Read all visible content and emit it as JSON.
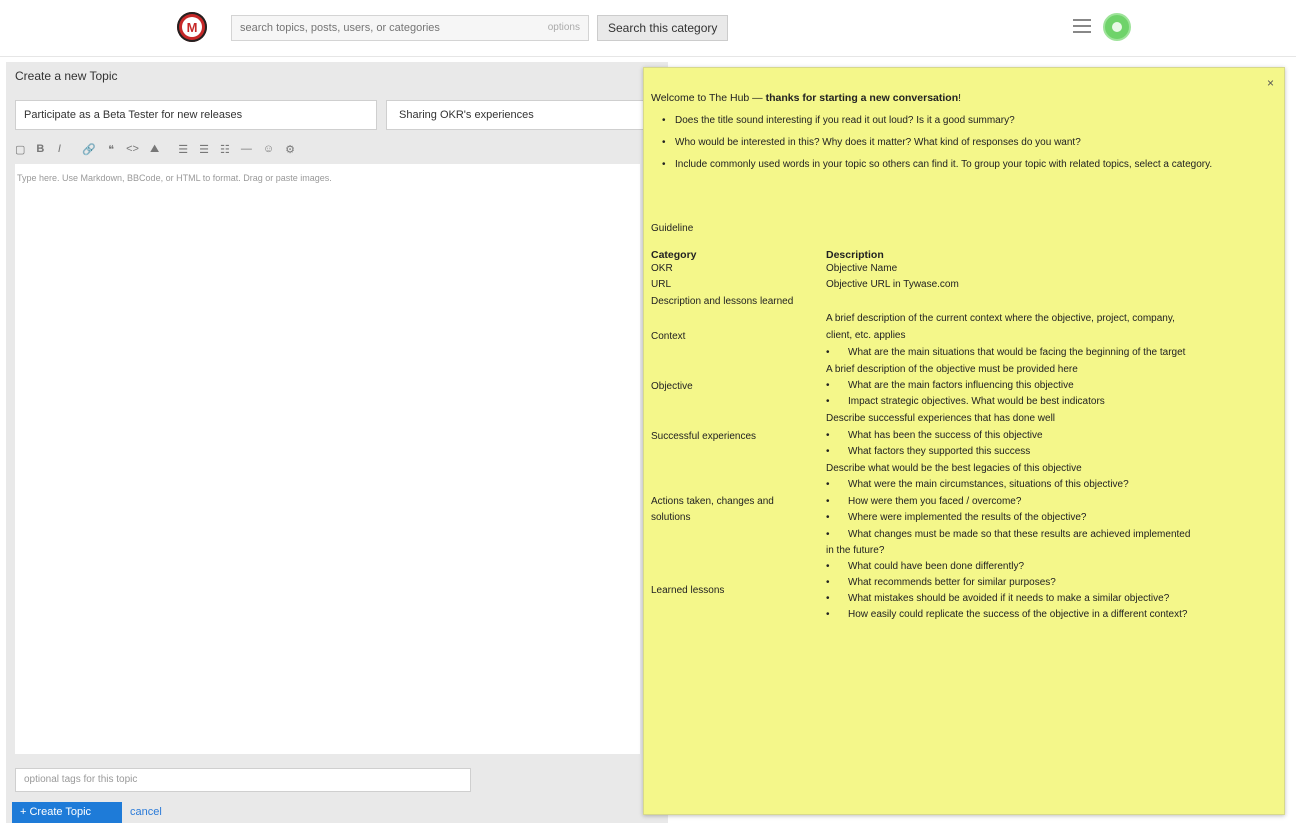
{
  "header": {
    "search_placeholder": "search topics, posts, users, or categories",
    "search_hint": "options",
    "search_button": "Search this category"
  },
  "composer": {
    "heading": "Create a new Topic",
    "title_value": "Participate as a Beta Tester for new releases",
    "category_value": "Sharing OKR's experiences",
    "toolbar": [
      "▢",
      "B",
      "I",
      "🔗",
      "❝",
      "<>",
      "⛰",
      "☰",
      "☰",
      "☷",
      "—",
      "☺",
      "⚙"
    ],
    "editor_placeholder": "Type here. Use Markdown, BBCode, or HTML to format. Drag or paste images.",
    "tags_placeholder": "optional tags for this topic",
    "create_label": "+ Create Topic",
    "cancel_label": "cancel"
  },
  "popup": {
    "close": "×",
    "welcome_prefix": "Welcome to The Hub — ",
    "welcome_bold": "thanks for starting a new conversation",
    "welcome_suffix": "!",
    "bullets": [
      "Does the title sound interesting if you read it out loud? Is it a good summary?",
      "Who would be interested in this? Why does it matter? What kind of responses do you want?",
      "Include commonly used words in your topic so others can find it. To group your topic with related topics, select a category."
    ],
    "guideline": "Guideline",
    "table": {
      "head_category": "Category",
      "head_description": "Description",
      "okr": "OKR",
      "okr_desc": "Objective Name",
      "url": "URL",
      "url_desc": "Objective URL in Tywase.com",
      "desc_lessons": "Description and lessons learned",
      "context": "Context",
      "context_desc_1": "A brief description of the current context where the objective, project, company,",
      "context_desc_2": "client, etc. applies",
      "context_b1": "What are the main situations that would be facing the beginning of the target",
      "objective_intro": "A brief description of the objective must be provided here",
      "objective": "Objective",
      "objective_b1": "What are the main factors influencing this objective",
      "objective_b2": "Impact strategic objectives. What would be best indicators",
      "success_intro": "Describe successful experiences that has done well",
      "success": "Successful experiences",
      "success_b1": "What has been the success of this objective",
      "success_b2": "What factors they supported this success",
      "actions_intro": "Describe what would be the best legacies of this objective",
      "actions_b1": "What were the main circumstances, situations of this objective?",
      "actions_1": "Actions taken, changes and",
      "actions_b2": "How were them you faced / overcome?",
      "actions_2": "solutions",
      "actions_b3": "Where were implemented the results of the objective?",
      "actions_b4_1": "What changes must be made so that these results are achieved implemented",
      "actions_b4_2": "in the future?",
      "lessons_b1": "What could have been done differently?",
      "lessons": "Learned lessons",
      "lessons_b2": "What recommends better for similar purposes?",
      "lessons_b3": "What mistakes should be avoided if it needs to make a similar objective?",
      "lessons_b4": "How easily could replicate the success of the objective in a different context?"
    }
  },
  "colors": {
    "popup_bg": "#f4f78a",
    "create_button": "#1e7bd8",
    "logo": "#c62828",
    "avatar": "#6fd36a"
  }
}
